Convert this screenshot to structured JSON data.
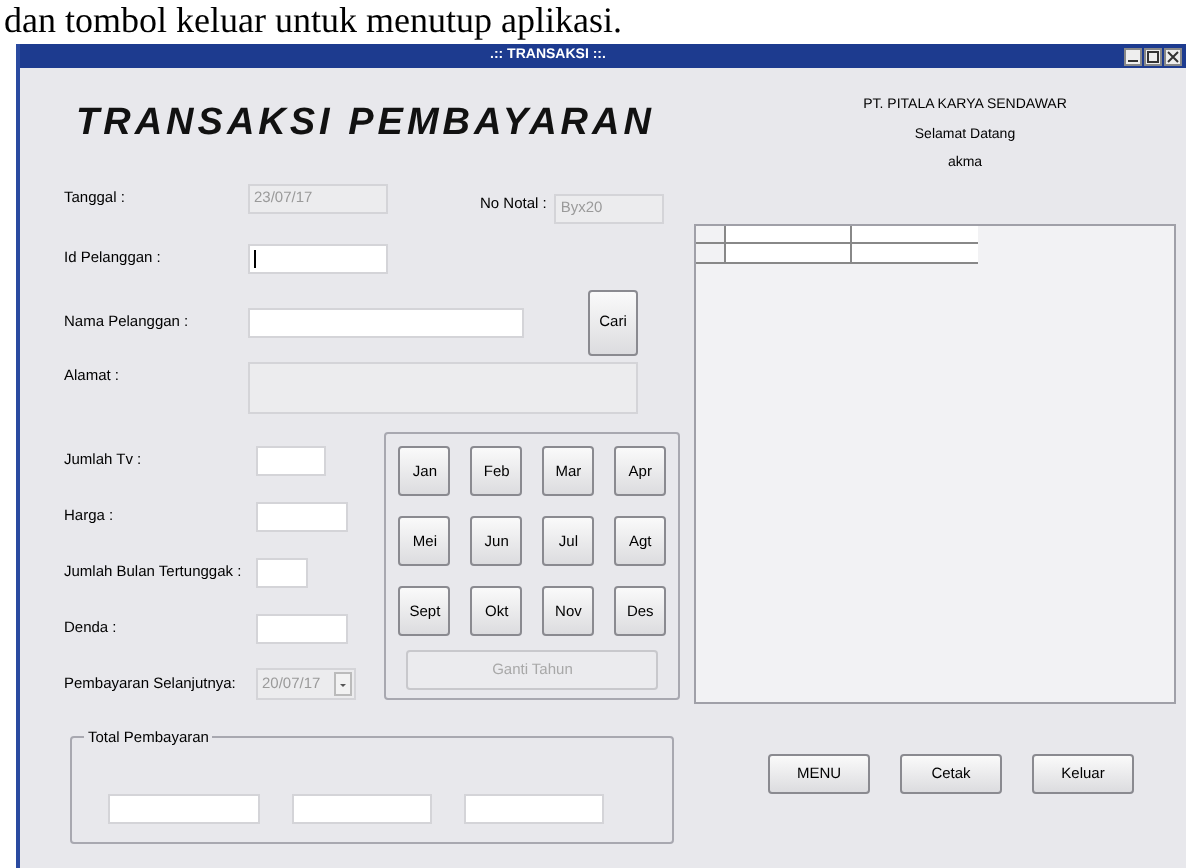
{
  "caption": "dan tombol keluar untuk menutup aplikasi.",
  "window": {
    "title": ".:: TRANSAKSI ::."
  },
  "header": {
    "title": "TRANSAKSI PEMBAYARAN",
    "company": "PT. PITALA KARYA SENDAWAR",
    "greeting": "Selamat Datang",
    "user": "akma"
  },
  "tanggal": {
    "label": "Tanggal :",
    "value": "23/07/17",
    "disabled": true
  },
  "no_nota": {
    "label": "No Notal :",
    "value": "Byx20",
    "disabled": true
  },
  "id_pelanggan": {
    "label": "Id Pelanggan :",
    "focused": true
  },
  "nama_pelanggan": {
    "label": "Nama Pelanggan :"
  },
  "cari_button": "Cari",
  "alamat": {
    "label": "Alamat :",
    "disabled": true
  },
  "fields": [
    {
      "kind": "text",
      "label": "Jumlah Tv :"
    },
    {
      "kind": "text",
      "label": "Harga :"
    },
    {
      "kind": "text",
      "label": "Jumlah Bulan Tertunggak :"
    },
    {
      "kind": "text",
      "label": "Denda :"
    },
    {
      "kind": "combo",
      "label": "Pembayaran Selanjutnya:",
      "value": "20/07/17",
      "disabled": true
    }
  ],
  "months": [
    "Jan",
    "Feb",
    "Mar",
    "Apr",
    "Mei",
    "Jun",
    "Jul",
    "Agt",
    "Sept",
    "Okt",
    "Nov",
    "Des"
  ],
  "year_button": {
    "label": "Ganti Tahun",
    "disabled": true
  },
  "total": {
    "label": "Total Pembayaran"
  },
  "buttons": [
    "MENU",
    "Cetak",
    "Keluar"
  ]
}
